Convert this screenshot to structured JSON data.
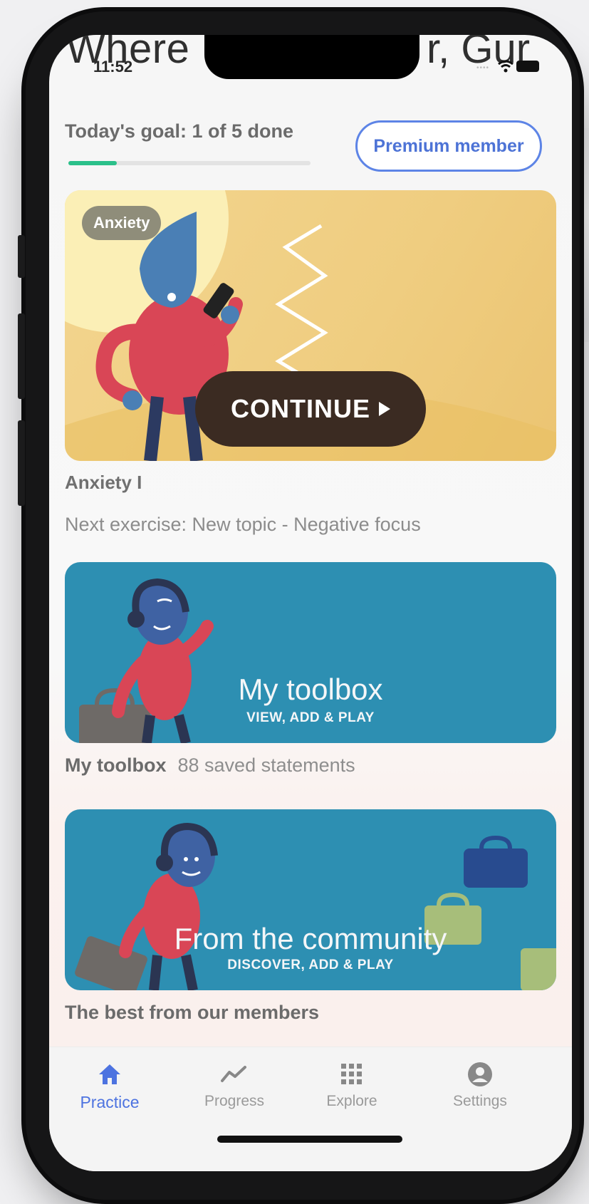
{
  "app": {
    "background_heading_left": "Where",
    "background_heading_right": "r, Gur"
  },
  "status_bar": {
    "time": "11:52"
  },
  "goal": {
    "text": "Today's goal: 1 of 5 done",
    "progress_fraction": 0.2,
    "progress_color": "#2bc08a"
  },
  "premium_button": {
    "label": "Premium member"
  },
  "current_course": {
    "tag": "Anxiety",
    "continue_label": "CONTINUE",
    "title": "Anxiety I",
    "next_exercise": "Next exercise: New topic - Negative focus"
  },
  "toolbox": {
    "card_title": "My toolbox",
    "card_subtitle": "VIEW, ADD & PLAY",
    "caption_title": "My toolbox",
    "caption_detail": "88 saved statements"
  },
  "community": {
    "card_title": "From the community",
    "card_subtitle": "DISCOVER, ADD & PLAY",
    "caption": "The best from our members"
  },
  "tabbar": {
    "tabs": [
      {
        "label": "Practice",
        "icon": "home-icon",
        "active": true
      },
      {
        "label": "Progress",
        "icon": "trend-line-icon",
        "active": false
      },
      {
        "label": "Explore",
        "icon": "grid-icon",
        "active": false
      },
      {
        "label": "Settings",
        "icon": "user-circle-icon",
        "active": false
      }
    ]
  },
  "colors": {
    "accent": "#4d73e0",
    "card_blue": "#2d8fb2",
    "card_yellow": "#f0cf86",
    "continue_button": "#3b2b22"
  }
}
